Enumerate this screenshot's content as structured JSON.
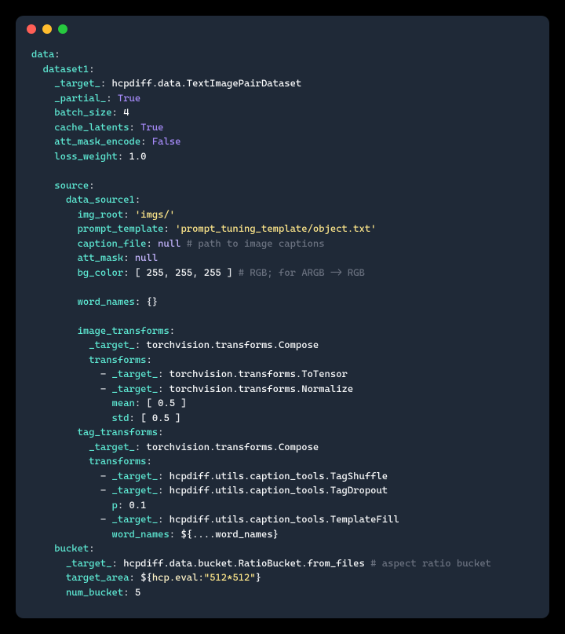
{
  "titlebar": {
    "buttons": [
      "close",
      "minimize",
      "zoom"
    ]
  },
  "yaml": {
    "l1": {
      "k": "data",
      "c": ":"
    },
    "l2": {
      "k": "dataset1",
      "c": ":"
    },
    "l3": {
      "k": "_target_",
      "c": ": ",
      "v": "hcpdiff.data.TextImagePairDataset"
    },
    "l4": {
      "k": "_partial_",
      "c": ": ",
      "v": "True"
    },
    "l5": {
      "k": "batch_size",
      "c": ": ",
      "v": "4"
    },
    "l6": {
      "k": "cache_latents",
      "c": ": ",
      "v": "True"
    },
    "l7": {
      "k": "att_mask_encode",
      "c": ": ",
      "v": "False"
    },
    "l8": {
      "k": "loss_weight",
      "c": ": ",
      "v": "1.0"
    },
    "l9": "",
    "l10": {
      "k": "source",
      "c": ":"
    },
    "l11": {
      "k": "data_source1",
      "c": ":"
    },
    "l12": {
      "k": "img_root",
      "c": ": ",
      "v": "'imgs/'"
    },
    "l13": {
      "k": "prompt_template",
      "c": ": ",
      "v": "'prompt_tuning_template/object.txt'"
    },
    "l14": {
      "k": "caption_file",
      "c": ": ",
      "v": "null",
      "cm": " # path to image captions"
    },
    "l15": {
      "k": "att_mask",
      "c": ": ",
      "v": "null"
    },
    "l16": {
      "k": "bg_color",
      "c": ": ",
      "lb": "[ ",
      "v1": "255",
      "sep": ", ",
      "v2": "255",
      "v3": "255",
      "rb": " ]",
      "cm": " # RGB; for ARGB -> RGB"
    },
    "l17": "",
    "l18": {
      "k": "word_names",
      "c": ": ",
      "v": "{}"
    },
    "l19": "",
    "l20": {
      "k": "image_transforms",
      "c": ":"
    },
    "l21": {
      "k": "_target_",
      "c": ": ",
      "v": "torchvision.transforms.Compose"
    },
    "l22": {
      "k": "transforms",
      "c": ":"
    },
    "l23": {
      "d": "- ",
      "k": "_target_",
      "c": ": ",
      "v": "torchvision.transforms.ToTensor"
    },
    "l24": {
      "d": "- ",
      "k": "_target_",
      "c": ": ",
      "v": "torchvision.transforms.Normalize"
    },
    "l25": {
      "k": "mean",
      "c": ": ",
      "lb": "[ ",
      "v": "0.5",
      "rb": " ]"
    },
    "l26": {
      "k": "std",
      "c": ": ",
      "lb": "[ ",
      "v": "0.5",
      "rb": " ]"
    },
    "l27": {
      "k": "tag_transforms",
      "c": ":"
    },
    "l28": {
      "k": "_target_",
      "c": ": ",
      "v": "torchvision.transforms.Compose"
    },
    "l29": {
      "k": "transforms",
      "c": ":"
    },
    "l30": {
      "d": "- ",
      "k": "_target_",
      "c": ": ",
      "v": "hcpdiff.utils.caption_tools.TagShuffle"
    },
    "l31": {
      "d": "- ",
      "k": "_target_",
      "c": ": ",
      "v": "hcpdiff.utils.caption_tools.TagDropout"
    },
    "l32": {
      "k": "p",
      "c": ": ",
      "v": "0.1"
    },
    "l33": {
      "d": "- ",
      "k": "_target_",
      "c": ": ",
      "v": "hcpdiff.utils.caption_tools.TemplateFill"
    },
    "l34": {
      "k": "word_names",
      "c": ": ",
      "v": "${....word_names}"
    },
    "l35": {
      "k": "bucket",
      "c": ":"
    },
    "l36": {
      "k": "_target_",
      "c": ": ",
      "v": "hcpdiff.data.bucket.RatioBucket.from_files",
      "cm": " # aspect ratio bucket"
    },
    "l37": {
      "k": "target_area",
      "c": ": ",
      "v1": "${",
      "v2": "hcp.eval:",
      "v3": "\"512*512\"",
      "v4": "}"
    },
    "l38": {
      "k": "num_bucket",
      "c": ": ",
      "v": "5"
    }
  }
}
